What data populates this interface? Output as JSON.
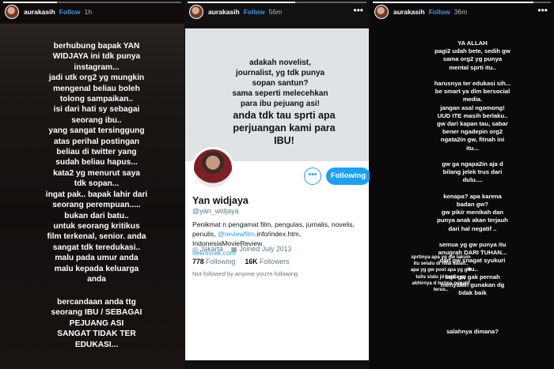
{
  "panels": [
    {
      "username": "aurakasih",
      "follow_label": "Follow",
      "time": "1h",
      "progress": 0.3,
      "text_top": "berhubung bapak YAN\nWIDJAYA ini tdk punya\ninstagram...\njadi utk org2 yg mungkin\nmengenal beliau boleh\ntolong sampaikan..\nisi dari hati sy sebagai\nseorang ibu..\nyang sangat tersinggung\natas perihal postingan\nbeliau di twitter yang\nsudah beliau hapus...\nkata2 yg menurut saya\ntdk sopan...\ningat pak.. bapak lahir dari\nseorang perempuan.....\nbukan dari batu..\nuntuk seorang kritikus\nfilm terkenal, senior. anda\nsangat tdk teredukasi..\nmalu pada umur anda\nmalu kepada keluarga\nanda",
      "text_bottom": "bercandaan anda ttg\nseorang IBU / SEBAGAI\nPEJUANG ASI\nSANGAT TIDAK TER\nEDUKASI..."
    },
    {
      "username": "aurakasih",
      "follow_label": "Follow",
      "time": "56m",
      "progress": 0.6,
      "more_icon": "more-horizontal-icon"
    },
    {
      "username": "aurakasih",
      "follow_label": "Follow",
      "time": "36m",
      "progress": 0.9,
      "more_icon": "more-horizontal-icon",
      "text_main": "YA ALLAH\npagi2 udah bete, sedih gw\nsama org2 yg punya\nmental sprti itu..\n\nharusnya ter edukasi sih...\nbe smart ya dlm bersocial\nmedia.\njangan asal ngomong!\nUUD ITE masih berlaku..\ngw dari kapan tau, sabar\nbener ngadepin org2\nngata2in gw, fitnah ini\nitu...\n\ngw ga ngapa2in aja d\nbilang jelek trus dari\ndulu....\n\nkenapa? apa karena\nbadan gw?\ngw pikir menikah dan\npunya anak akan terjauh\ndari hal negatif ..\n\nsemua yg gw punya itu\nanugrah DARI TUHAN...\ndan gw snagat syukuri\nitu..\ntapi gw gak pernah\nmenyalah gunakan dg\ntidak baik",
      "text_small": "sprtinya apa yg gw lakuin\nitu selalu di nilai salah..\napa yg gw post apa yg gw\ntulis slalu jd berita yg\nakhirnya d terima negatif\nterus..",
      "text_end": "salahnya dimana?"
    }
  ],
  "twitter": {
    "quote_small": "adakah novelist,\njournalist, yg tdk punya\nsopan santun?\nsama seperti melecehkan\npara ibu pejuang asi!",
    "quote_big": "anda tdk tau sprti apa\nperjuangan kami para\nIBU!",
    "name": "Yan widjaya",
    "handle": "@yan_widjaya",
    "bio_line1": "Penikmat n pengamat film, pengulas, jurnalis,  novelis,",
    "bio_pre": "penulis, ",
    "bio_link": "@reviewfilm",
    "bio_post": ".info/index.htm, IndonesiaMovieReview",
    "bio_link2": "ceknricek.com",
    "location": "Jakarta",
    "joined": "Joined July 2013",
    "following_count": "778",
    "following_label": "Following",
    "followers_count": "16K",
    "followers_label": "Followers",
    "not_followed": "Not followed by anyone you're following",
    "more_label": "•••",
    "follow_button": "Following",
    "accent": "#1da1f2"
  }
}
